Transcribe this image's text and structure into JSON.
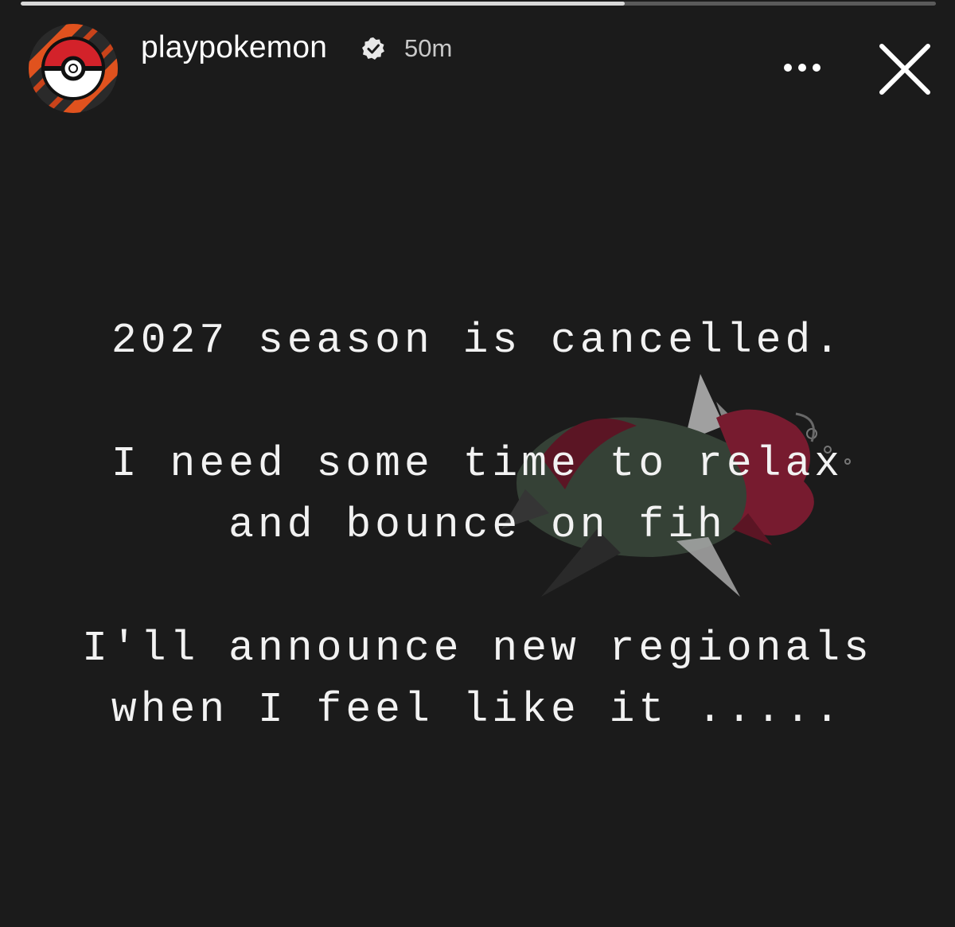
{
  "story": {
    "progress_percent": 66,
    "colors": {
      "background": "#1b1b1b",
      "text": "#f2f2f2",
      "avatar_orange": "#e0521e",
      "pokeball_red": "#d3222a"
    }
  },
  "header": {
    "avatar_icon": "pokeball-logo-icon",
    "username": "playpokemon",
    "verified_icon": "verified-badge-icon",
    "timestamp": "50m",
    "more_icon": "more-options-icon",
    "close_icon": "close-icon"
  },
  "artwork": {
    "icon": "pokemon-artwork-icon"
  },
  "message": {
    "line1": "2027 season is cancelled.",
    "line2": "I need some time to relax",
    "line3": "and bounce on fih",
    "line4": "I'll announce new regionals",
    "line5": "when I feel like it ....."
  }
}
